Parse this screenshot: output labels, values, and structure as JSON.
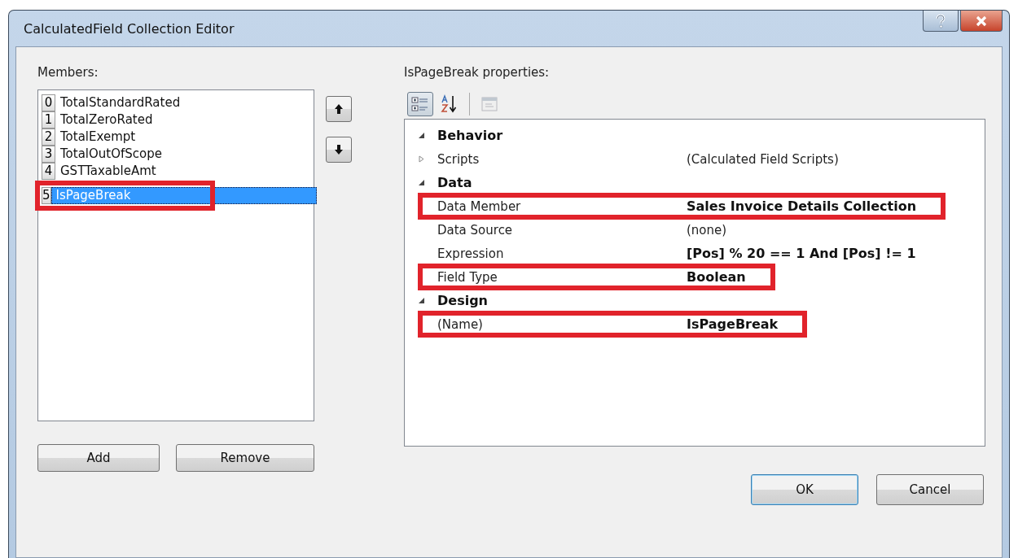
{
  "window": {
    "title": "CalculatedField Collection Editor"
  },
  "members": {
    "label": "Members:",
    "items": [
      {
        "index": "0",
        "name": "TotalStandardRated",
        "selected": false,
        "highlighted": false
      },
      {
        "index": "1",
        "name": "TotalZeroRated",
        "selected": false,
        "highlighted": false
      },
      {
        "index": "2",
        "name": "TotalExempt",
        "selected": false,
        "highlighted": false
      },
      {
        "index": "3",
        "name": "TotalOutOfScope",
        "selected": false,
        "highlighted": false
      },
      {
        "index": "4",
        "name": "GSTTaxableAmt",
        "selected": false,
        "highlighted": false
      },
      {
        "index": "5",
        "name": "IsPageBreak",
        "selected": true,
        "highlighted": true
      }
    ]
  },
  "member_buttons": [
    "Add",
    "Remove"
  ],
  "properties": {
    "label": "IsPageBreak properties:",
    "toolbar": [
      {
        "kind": "categorized",
        "selected": true,
        "disabled": false
      },
      {
        "kind": "alphabetical",
        "selected": false,
        "disabled": false
      },
      {
        "kind": "pages",
        "selected": false,
        "disabled": true
      }
    ],
    "rows": [
      {
        "kind": "category",
        "name": "Behavior",
        "expanded": true
      },
      {
        "kind": "property",
        "name": "Scripts",
        "value": "(Calculated Field Scripts)",
        "bold": false,
        "expandable": true,
        "highlighted": false
      },
      {
        "kind": "category",
        "name": "Data",
        "expanded": true
      },
      {
        "kind": "property",
        "name": "Data Member",
        "value": "Sales Invoice Details Collection",
        "bold": true,
        "expandable": false,
        "highlighted": true
      },
      {
        "kind": "property",
        "name": "Data Source",
        "value": "(none)",
        "bold": false,
        "expandable": false,
        "highlighted": false
      },
      {
        "kind": "property",
        "name": "Expression",
        "value": "[Pos] % 20 == 1 And [Pos] != 1",
        "bold": true,
        "expandable": false,
        "highlighted": false
      },
      {
        "kind": "property",
        "name": "Field Type",
        "value": "Boolean",
        "bold": true,
        "expandable": false,
        "highlighted": true
      },
      {
        "kind": "category",
        "name": "Design",
        "expanded": true
      },
      {
        "kind": "property",
        "name": "(Name)",
        "value": "IsPageBreak",
        "bold": true,
        "expandable": false,
        "highlighted": true
      }
    ]
  },
  "dialog_buttons": [
    {
      "label": "OK",
      "default": true
    },
    {
      "label": "Cancel",
      "default": false
    }
  ]
}
